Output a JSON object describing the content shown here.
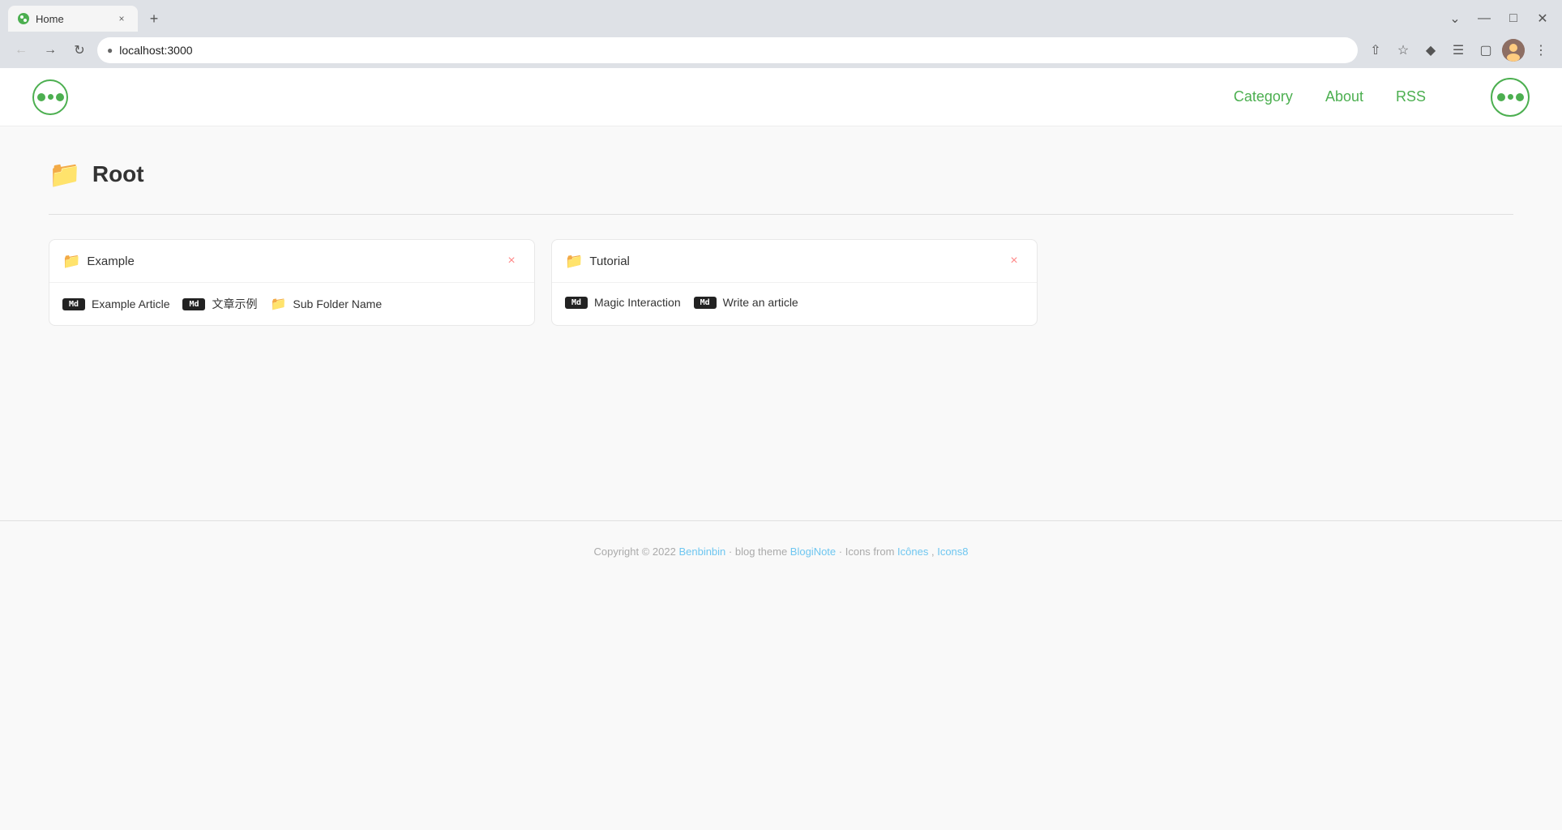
{
  "browser": {
    "tab_title": "Home",
    "tab_icon": "circle-icon",
    "address": "localhost:3000",
    "new_tab_label": "+",
    "close_tab": "×",
    "window_controls": {
      "minimize": "—",
      "maximize": "□",
      "close": "✕",
      "dropdown": "⌄"
    }
  },
  "site": {
    "logo_icon": "bloginote-logo",
    "nav": {
      "category": "Category",
      "about": "About",
      "rss": "RSS"
    }
  },
  "page": {
    "title": "Root",
    "folders": [
      {
        "id": "example",
        "name": "Example",
        "articles": [
          {
            "type": "markdown",
            "label": "Md",
            "title": "Example Article"
          },
          {
            "type": "markdown",
            "label": "Md",
            "title": "文章示例"
          },
          {
            "type": "folder",
            "title": "Sub Folder Name"
          }
        ]
      },
      {
        "id": "tutorial",
        "name": "Tutorial",
        "articles": [
          {
            "type": "markdown",
            "label": "Md",
            "title": "Magic Interaction"
          },
          {
            "type": "markdown",
            "label": "Md",
            "title": "Write an article"
          }
        ]
      }
    ]
  },
  "footer": {
    "copyright": "Copyright © 2022",
    "author": "Benbinbin",
    "middle": " · blog theme ",
    "theme": "BlogiNote",
    "icons_prefix": " · Icons from ",
    "icones": "Icônes",
    "comma": ", ",
    "icons8": "Icons8"
  }
}
